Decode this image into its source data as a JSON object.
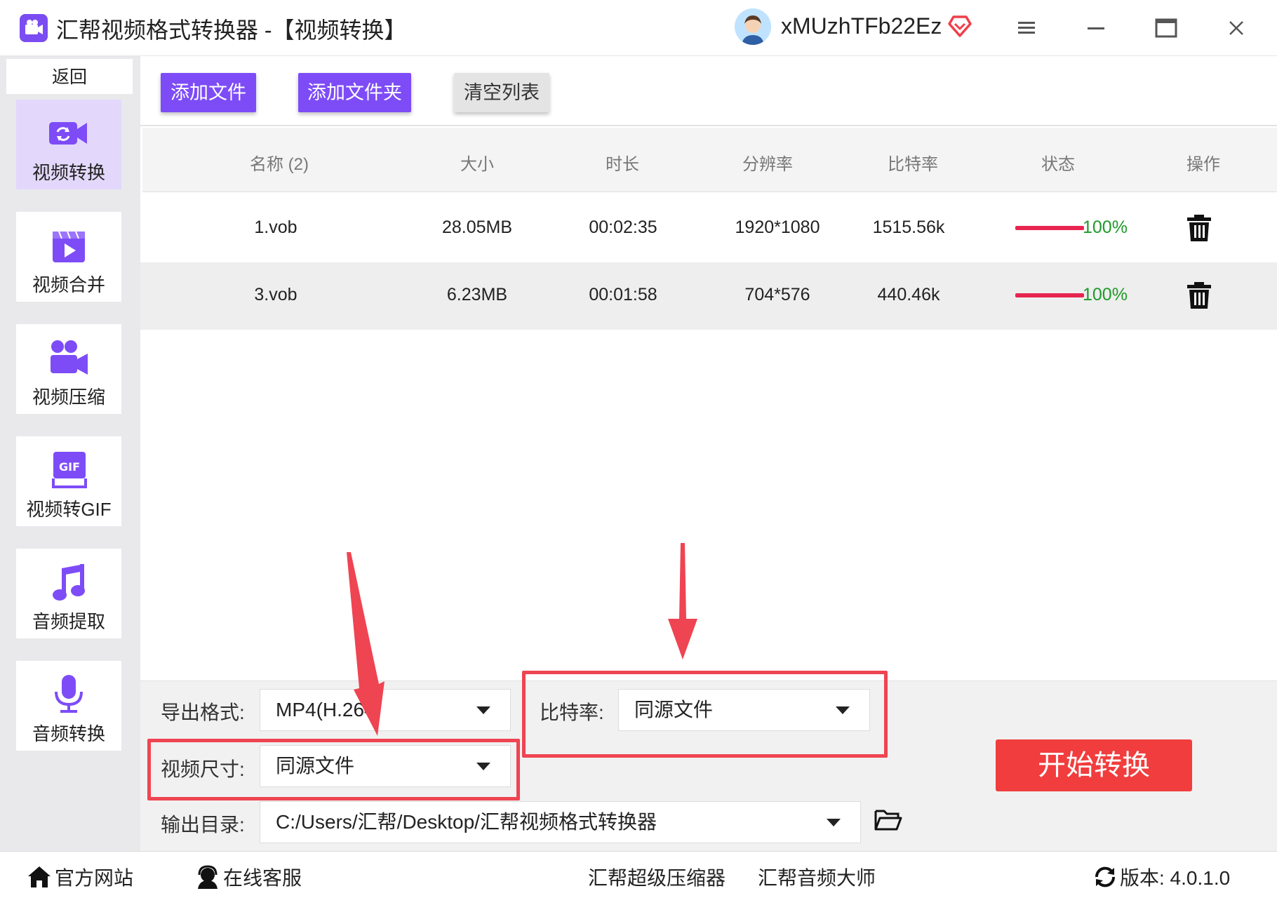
{
  "window": {
    "title": "汇帮视频格式转换器  -【视频转换】",
    "username": "xMUzhTFb22Ez"
  },
  "sidebar": {
    "back_label": "返回",
    "items": [
      {
        "label": "视频转换",
        "icon": "video-convert-icon",
        "active": true
      },
      {
        "label": "视频合并",
        "icon": "video-merge-icon"
      },
      {
        "label": "视频压缩",
        "icon": "video-compress-icon"
      },
      {
        "label": "视频转GIF",
        "icon": "gif-icon"
      },
      {
        "label": "音频提取",
        "icon": "music-note-icon"
      },
      {
        "label": "音频转换",
        "icon": "microphone-icon"
      }
    ]
  },
  "toolbar": {
    "add_file": "添加文件",
    "add_folder": "添加文件夹",
    "clear_list": "清空列表"
  },
  "table": {
    "columns": [
      "名称 (2)",
      "大小",
      "时长",
      "分辨率",
      "比特率",
      "状态",
      "操作"
    ],
    "rows": [
      {
        "name": "1.vob",
        "size": "28.05MB",
        "duration": "00:02:35",
        "resolution": "1920*1080",
        "bitrate": "1515.56k",
        "status": "100%",
        "progress": 1.0
      },
      {
        "name": "3.vob",
        "size": "6.23MB",
        "duration": "00:01:58",
        "resolution": "704*576",
        "bitrate": "440.46k",
        "status": "100%",
        "progress": 1.0
      }
    ]
  },
  "settings": {
    "format_label": "导出格式:",
    "format_value": "MP4(H.264)",
    "bitrate_label": "比特率:",
    "bitrate_value": "同源文件",
    "size_label": "视频尺寸:",
    "size_value": "同源文件",
    "output_label": "输出目录:",
    "output_value": "C:/Users/汇帮/Desktop/汇帮视频格式转换器",
    "start_button": "开始转换"
  },
  "statusbar": {
    "website": "官方网站",
    "support": "在线客服",
    "compressor": "汇帮超级压缩器",
    "audio_master": "汇帮音频大师",
    "version": "版本: 4.0.1.0"
  },
  "colors": {
    "accent": "#7d4cf7",
    "highlight": "#ef4452",
    "start": "#f13d3d",
    "progress": "#e8254f",
    "progress_text": "#1e9a2a"
  }
}
